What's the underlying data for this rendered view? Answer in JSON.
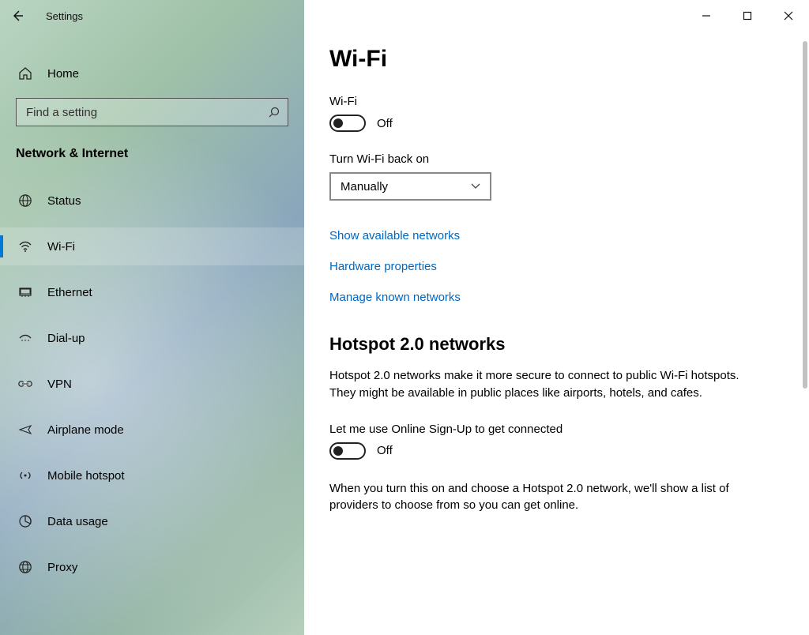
{
  "window": {
    "app_name": "Settings"
  },
  "sidebar": {
    "home_label": "Home",
    "search_placeholder": "Find a setting",
    "category_label": "Network & Internet",
    "items": [
      {
        "id": "status",
        "label": "Status",
        "icon": "globe-icon"
      },
      {
        "id": "wifi",
        "label": "Wi-Fi",
        "icon": "wifi-icon",
        "selected": true
      },
      {
        "id": "ethernet",
        "label": "Ethernet",
        "icon": "ethernet-icon"
      },
      {
        "id": "dialup",
        "label": "Dial-up",
        "icon": "dialup-icon"
      },
      {
        "id": "vpn",
        "label": "VPN",
        "icon": "vpn-icon"
      },
      {
        "id": "airplane",
        "label": "Airplane mode",
        "icon": "airplane-icon"
      },
      {
        "id": "hotspot",
        "label": "Mobile hotspot",
        "icon": "hotspot-icon"
      },
      {
        "id": "datausage",
        "label": "Data usage",
        "icon": "datausage-icon"
      },
      {
        "id": "proxy",
        "label": "Proxy",
        "icon": "proxy-icon"
      }
    ]
  },
  "main": {
    "page_title": "Wi-Fi",
    "wifi_toggle": {
      "label": "Wi-Fi",
      "state_text": "Off",
      "on": false
    },
    "turn_back_on": {
      "label": "Turn Wi-Fi back on",
      "selected": "Manually"
    },
    "links": {
      "show_networks": "Show available networks",
      "hardware_props": "Hardware properties",
      "manage_known": "Manage known networks"
    },
    "hotspot20": {
      "heading": "Hotspot 2.0 networks",
      "description": "Hotspot 2.0 networks make it more secure to connect to public Wi-Fi hotspots. They might be available in public places like airports, hotels, and cafes.",
      "signup_label": "Let me use Online Sign-Up to get connected",
      "signup_state": "Off",
      "signup_on": false,
      "footer": "When you turn this on and choose a Hotspot 2.0 network, we'll show a list of providers to choose from so you can get online."
    }
  }
}
